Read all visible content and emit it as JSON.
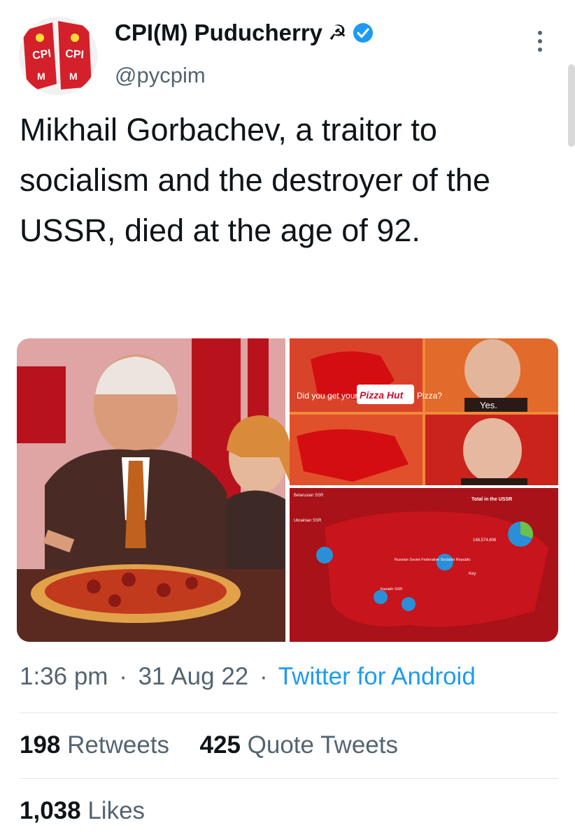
{
  "author": {
    "display_name": "CPI(M) Puducherry",
    "emoji": "☭",
    "handle": "@pycpim",
    "avatar_flag_text": "CPI M",
    "verified_icon": "verified-badge-icon",
    "menu_icon": "vertical-ellipsis-icon"
  },
  "tweet": {
    "text": "Mikhail Gorbachev, a traitor to socialism and the destroyer of the USSR, died at the age of 92."
  },
  "media": {
    "meme": {
      "top_left_caption": "Did you get your",
      "top_right_caption": "Pizza?",
      "logo_text": "Pizza Hut",
      "answer": "Yes."
    },
    "infographic": {
      "total_title": "Total in the USSR",
      "total_value": "148,574,606",
      "rsfsr_label": "Russian Soviet Federative Socialist Republic",
      "kazakh_label": "Kazakh SSR",
      "key_label": "Key",
      "ukraine_label": "Ukrainian SSR",
      "belarus_label": "Belarusian SSR"
    }
  },
  "meta": {
    "time": "1:36 pm",
    "date": "31 Aug 22",
    "source": "Twitter for Android",
    "separator": "·"
  },
  "stats": {
    "retweets_count": "198",
    "retweets_label": "Retweets",
    "quotes_count": "425",
    "quotes_label": "Quote Tweets",
    "likes_count": "1,038",
    "likes_label": "Likes"
  },
  "colors": {
    "verified": "#1d9bf0",
    "link": "#1d9bf0",
    "secondary_text": "#536471",
    "primary_text": "#0f1419",
    "infographic_red": "#b3131b"
  }
}
